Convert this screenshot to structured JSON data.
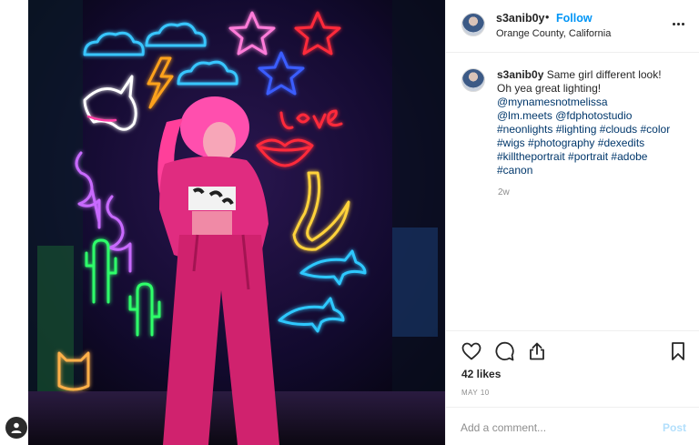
{
  "post": {
    "username": "s3anib0y",
    "separator": "•",
    "follow_label": "Follow",
    "location": "Orange County, California"
  },
  "caption": {
    "username": "s3anib0y",
    "line1": "Same girl different look!",
    "line2": "Oh yea great lighting!",
    "mentions": [
      "@mynamesnotmelissa",
      "@lm.meets",
      "@fdphotostudio"
    ],
    "hashtags": [
      "#neonlights",
      "#lighting",
      "#clouds",
      "#color",
      "#wigs",
      "#photography",
      "#dexedits",
      "#killtheportrait",
      "#portrait",
      "#adobe",
      "#canon"
    ],
    "time_ago": "2w"
  },
  "actions": {
    "like_icon": "heart-icon",
    "comment_icon": "comment-icon",
    "share_icon": "share-icon",
    "save_icon": "bookmark-icon",
    "likes": "42 likes",
    "date": "MAY 10"
  },
  "comment": {
    "placeholder": "Add a comment...",
    "post_label": "Post"
  },
  "colors": {
    "follow": "#0095f6",
    "hashtag": "#00376b",
    "post_disabled": "#b2dffc",
    "muted": "#8e8e8e"
  }
}
